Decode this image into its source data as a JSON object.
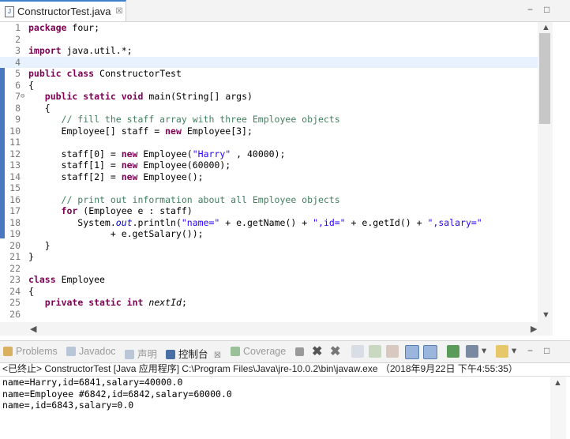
{
  "editor_tab": {
    "title": "ConstructorTest.java",
    "close": "☒"
  },
  "window_buttons": {
    "minimize": "−",
    "maximize": "□"
  },
  "code_lines": [
    {
      "n": "1",
      "segs": [
        [
          "kw",
          "package"
        ],
        [
          "",
          "four;"
        ]
      ]
    },
    {
      "n": "2",
      "segs": []
    },
    {
      "n": "3",
      "segs": [
        [
          "kw",
          "import"
        ],
        [
          "",
          "java.util.*;"
        ]
      ]
    },
    {
      "n": "4",
      "segs": [],
      "current": true
    },
    {
      "n": "5",
      "segs": [
        [
          "kw",
          "public"
        ],
        [
          "",
          ""
        ],
        [
          "kw",
          "class"
        ],
        [
          "",
          "ConstructorTest"
        ]
      ]
    },
    {
      "n": "6",
      "segs": [
        [
          "",
          "{"
        ]
      ]
    },
    {
      "n": "7",
      "segs": [
        [
          "",
          "   "
        ],
        [
          "kw",
          "public"
        ],
        [
          "",
          ""
        ],
        [
          "kw",
          "static"
        ],
        [
          "",
          ""
        ],
        [
          "kw",
          "void"
        ],
        [
          "",
          "main(String[] args)"
        ]
      ],
      "fold": true
    },
    {
      "n": "8",
      "segs": [
        [
          "",
          "   {"
        ]
      ]
    },
    {
      "n": "9",
      "segs": [
        [
          "cm",
          "      // fill the staff array with three Employee objects"
        ]
      ]
    },
    {
      "n": "10",
      "segs": [
        [
          "",
          "      Employee[] staff = "
        ],
        [
          "kw",
          "new"
        ],
        [
          "",
          "Employee[3];"
        ]
      ]
    },
    {
      "n": "11",
      "segs": []
    },
    {
      "n": "12",
      "segs": [
        [
          "",
          "      staff[0] = "
        ],
        [
          "kw",
          "new"
        ],
        [
          "",
          "Employee("
        ],
        [
          "st",
          "\"Harry\""
        ],
        [
          "",
          ", 40000);"
        ]
      ]
    },
    {
      "n": "13",
      "segs": [
        [
          "",
          "      staff[1] = "
        ],
        [
          "kw",
          "new"
        ],
        [
          "",
          "Employee(60000);"
        ]
      ]
    },
    {
      "n": "14",
      "segs": [
        [
          "",
          "      staff[2] = "
        ],
        [
          "kw",
          "new"
        ],
        [
          "",
          "Employee();"
        ]
      ]
    },
    {
      "n": "15",
      "segs": []
    },
    {
      "n": "16",
      "segs": [
        [
          "cm",
          "      // print out information about all Employee objects"
        ]
      ]
    },
    {
      "n": "17",
      "segs": [
        [
          "",
          "      "
        ],
        [
          "kw",
          "for"
        ],
        [
          "",
          "(Employee e : staff)"
        ]
      ]
    },
    {
      "n": "18",
      "segs": [
        [
          "",
          "         System."
        ],
        [
          "sf",
          "out"
        ],
        [
          "",
          ".println("
        ],
        [
          "st",
          "\"name=\""
        ],
        [
          "",
          "+ e.getName() + "
        ],
        [
          "st",
          "\",id=\""
        ],
        [
          "",
          "+ e.getId() + "
        ],
        [
          "st",
          "\",salary=\""
        ]
      ]
    },
    {
      "n": "19",
      "segs": [
        [
          "",
          "               + e.getSalary());"
        ]
      ]
    },
    {
      "n": "20",
      "segs": [
        [
          "",
          "   }"
        ]
      ]
    },
    {
      "n": "21",
      "segs": [
        [
          "",
          "}"
        ]
      ]
    },
    {
      "n": "22",
      "segs": []
    },
    {
      "n": "23",
      "segs": [
        [
          "kw",
          "class"
        ],
        [
          "",
          "Employee"
        ]
      ]
    },
    {
      "n": "24",
      "segs": [
        [
          "",
          "{"
        ]
      ]
    },
    {
      "n": "25",
      "segs": [
        [
          "",
          "   "
        ],
        [
          "kw",
          "private"
        ],
        [
          "",
          ""
        ],
        [
          "kw",
          "static"
        ],
        [
          "",
          ""
        ],
        [
          "kw",
          "int"
        ],
        [
          "it",
          "nextId"
        ],
        [
          "",
          ";"
        ]
      ]
    },
    {
      "n": "26",
      "segs": []
    }
  ],
  "console_tabs": [
    {
      "label": "Problems",
      "active": false,
      "color": "#c9a04a"
    },
    {
      "label": "Javadoc",
      "active": false,
      "color": "#8aa0c0"
    },
    {
      "label": "声明",
      "active": false,
      "color": "#9ab0d0"
    },
    {
      "label": "控制台",
      "active": true,
      "color": "#4a6fa5",
      "close": "☒"
    },
    {
      "label": "Coverage",
      "active": false,
      "color": "#7aa07a"
    }
  ],
  "console_header": "<已终止> ConstructorTest [Java 应用程序] C:\\Program Files\\Java\\jre-10.0.2\\bin\\javaw.exe （2018年9月22日 下午4:55:35）",
  "console_output": [
    "name=Harry,id=6841,salary=40000.0",
    "name=Employee #6842,id=6842,salary=60000.0",
    "name=,id=6843,salary=0.0"
  ],
  "colors": {
    "keyword": "#7f0055",
    "comment": "#3f7f5f",
    "string": "#2a00ff",
    "static_field": "#0000c0"
  }
}
